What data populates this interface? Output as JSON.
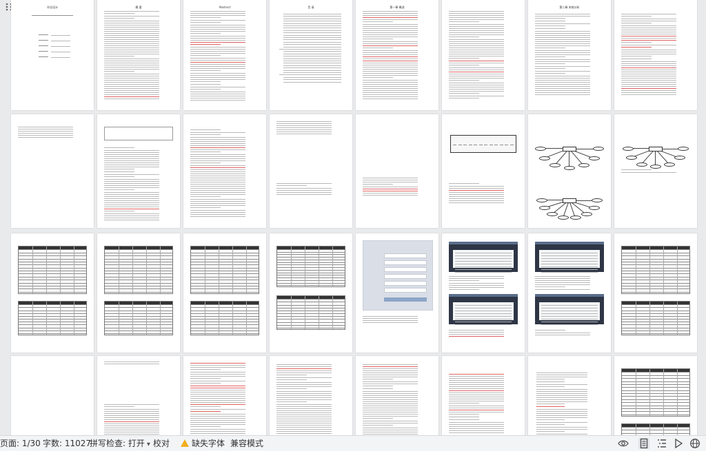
{
  "status_bar": {
    "page_indicator": "页面: 1/30",
    "word_count": "字数: 11027",
    "spell_check": "拼写检查: 打开",
    "proofread": "校对",
    "missing_fonts": "缺失字体",
    "compat_mode": "兼容模式"
  },
  "pages": [
    {
      "title": "毕业设计"
    },
    {
      "title": "摘  要"
    },
    {
      "title": "Abstract"
    },
    {
      "title": "目  录"
    },
    {
      "title": "第一章  概述"
    },
    {
      "title": ""
    },
    {
      "title": "第二章  系统分析"
    },
    {
      "title": ""
    }
  ],
  "icons": {
    "drag": "drag-handle-icon",
    "eye": "eye-icon",
    "page_view": "page-view-icon",
    "outline": "outline-icon",
    "play": "play-icon",
    "web": "globe-icon",
    "warning": "warning-icon"
  },
  "colors": {
    "background": "#e9eaec",
    "page": "#ffffff",
    "warning": "#f2b01e",
    "status_bar": "#f3f4f6"
  }
}
